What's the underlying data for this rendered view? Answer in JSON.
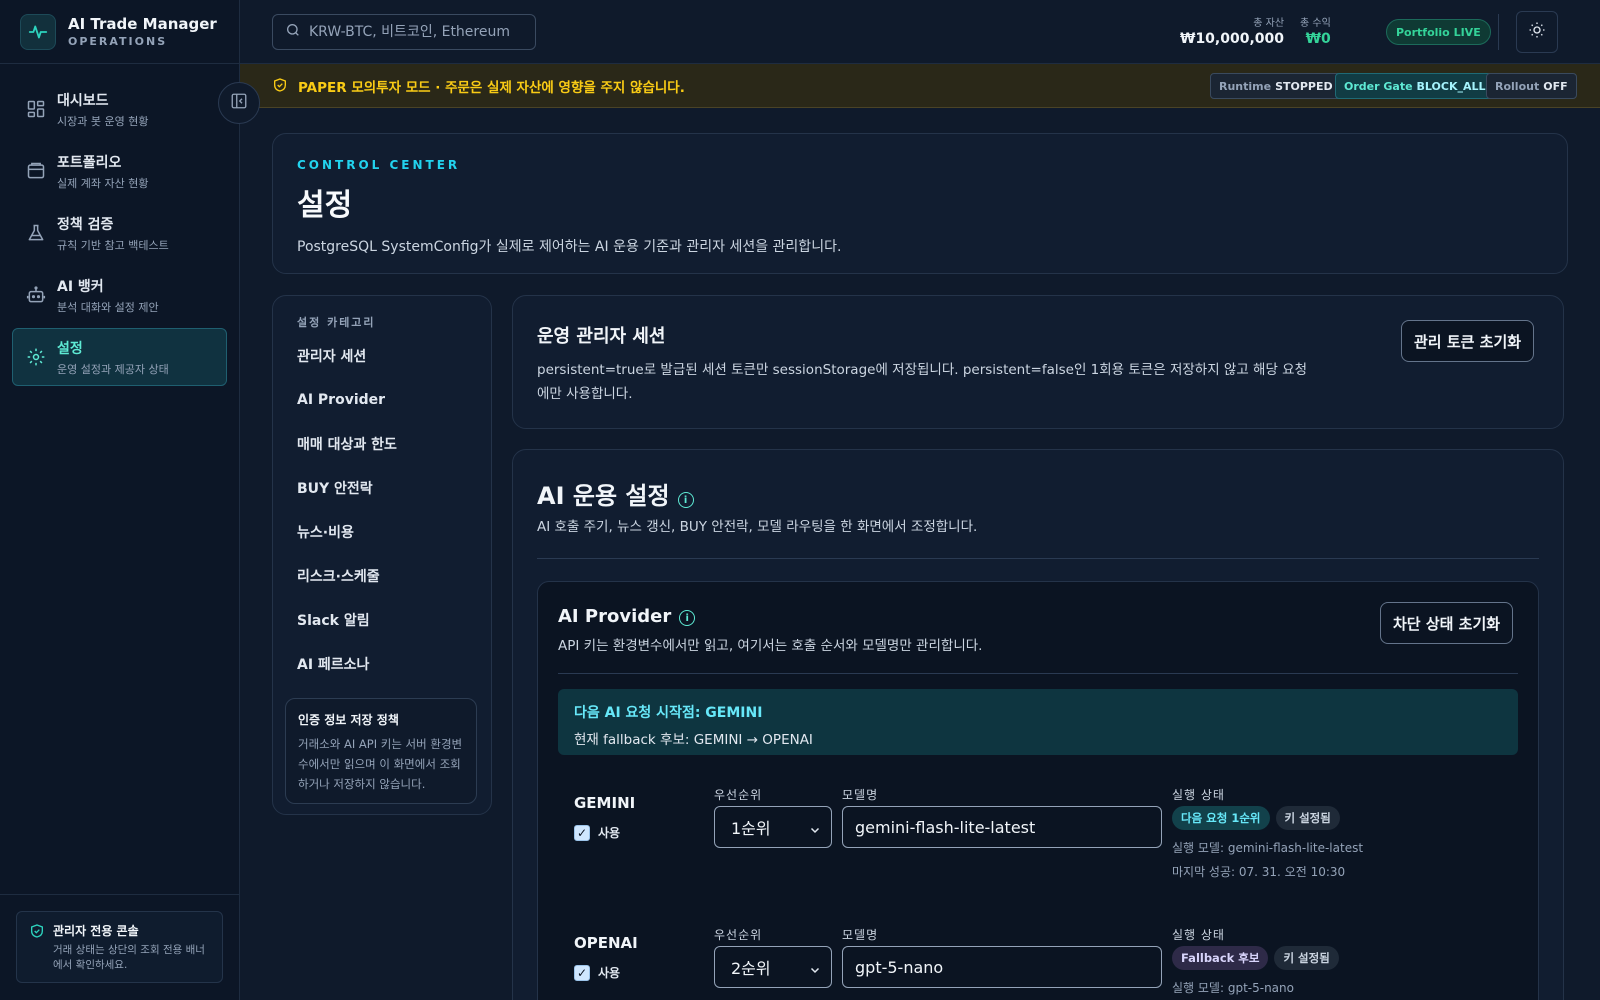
{
  "brand": {
    "title": "AI Trade Manager",
    "subtitle": "OPERATIONS"
  },
  "sidebar": {
    "items": [
      {
        "label": "대시보드",
        "desc": "시장과 봇 운영 현황",
        "icon": "grid-icon"
      },
      {
        "label": "포트폴리오",
        "desc": "실제 계좌 자산 현황",
        "icon": "wallet-icon"
      },
      {
        "label": "정책 검증",
        "desc": "규칙 기반 참고 백테스트",
        "icon": "flask-icon"
      },
      {
        "label": "AI 뱅커",
        "desc": "분석 대화와 설정 제안",
        "icon": "robot-icon"
      },
      {
        "label": "설정",
        "desc": "운영 설정과 제공자 상태",
        "icon": "gear-icon",
        "active": true
      }
    ],
    "footer": {
      "title": "관리자 전용 콘솔",
      "desc": "거래 상태는 상단의 조회 전용 배너에서 확인하세요."
    }
  },
  "topbar": {
    "search_placeholder": "KRW-BTC, 비트코인, Ethereum",
    "total_assets_label": "총 자산",
    "total_assets_value": "₩10,000,000",
    "total_profit_label": "총 수익",
    "total_profit_value": "₩0",
    "portfolio_status": "Portfolio LIVE"
  },
  "banner": {
    "text": "PAPER 모의투자 모드 · 주문은 실제 자산에 영향을 주지 않습니다.",
    "chips": [
      {
        "label": "Runtime",
        "value": "STOPPED"
      },
      {
        "label": "Order Gate",
        "value": "BLOCK_ALL"
      },
      {
        "label": "Rollout",
        "value": "OFF"
      }
    ]
  },
  "hero": {
    "eyebrow": "CONTROL CENTER",
    "title": "설정",
    "desc": "PostgreSQL SystemConfig가 실제로 제어하는 AI 운용 기준과 관리자 세션을 관리합니다."
  },
  "categories": {
    "heading": "설정 카테고리",
    "items": [
      "관리자 세션",
      "AI Provider",
      "매매 대상과 한도",
      "BUY 안전락",
      "뉴스·비용",
      "리스크·스케줄",
      "Slack 알림",
      "AI 페르소나"
    ],
    "policy_title": "인증 정보 저장 정책",
    "policy_desc": "거래소와 AI API 키는 서버 환경변수에서만 읽으며 이 화면에서 조회하거나 저장하지 않습니다."
  },
  "session": {
    "title": "운영 관리자 세션",
    "desc": "persistent=true로 발급된 세션 토큰만 sessionStorage에 저장됩니다. persistent=false인 1회용 토큰은 저장하지 않고 해당 요청에만 사용합니다.",
    "reset_button": "관리 토큰 초기화"
  },
  "ai_ops": {
    "title": "AI 운용 설정",
    "desc": "AI 호출 주기, 뉴스 갱신, BUY 안전락, 모델 라우팅을 한 화면에서 조정합니다."
  },
  "provider": {
    "title": "AI Provider",
    "desc": "API 키는 환경변수에서만 읽고, 여기서는 호출 순서와 모델명만 관리합니다.",
    "reset_button": "차단 상태 초기화",
    "next_title": "다음 AI 요청 시작점: GEMINI",
    "next_desc": "현재 fallback 후보: GEMINI → OPENAI",
    "priority_label": "우선순위",
    "model_label": "모델명",
    "status_label": "실행 상태",
    "enable_label": "사용",
    "rows": [
      {
        "name": "GEMINI",
        "priority": "1순위",
        "model": "gemini-flash-lite-latest",
        "badge_primary": "다음 요청 1순위",
        "badge_key": "키 설정됨",
        "run_model": "실행 모델: gemini-flash-lite-latest",
        "last_success": "마지막 성공: 07. 31. 오전 10:30"
      },
      {
        "name": "OPENAI",
        "priority": "2순위",
        "model": "gpt-5-nano",
        "badge_primary": "Fallback 후보",
        "badge_key": "키 설정됨",
        "run_model": "실행 모델: gpt-5-nano"
      }
    ]
  }
}
